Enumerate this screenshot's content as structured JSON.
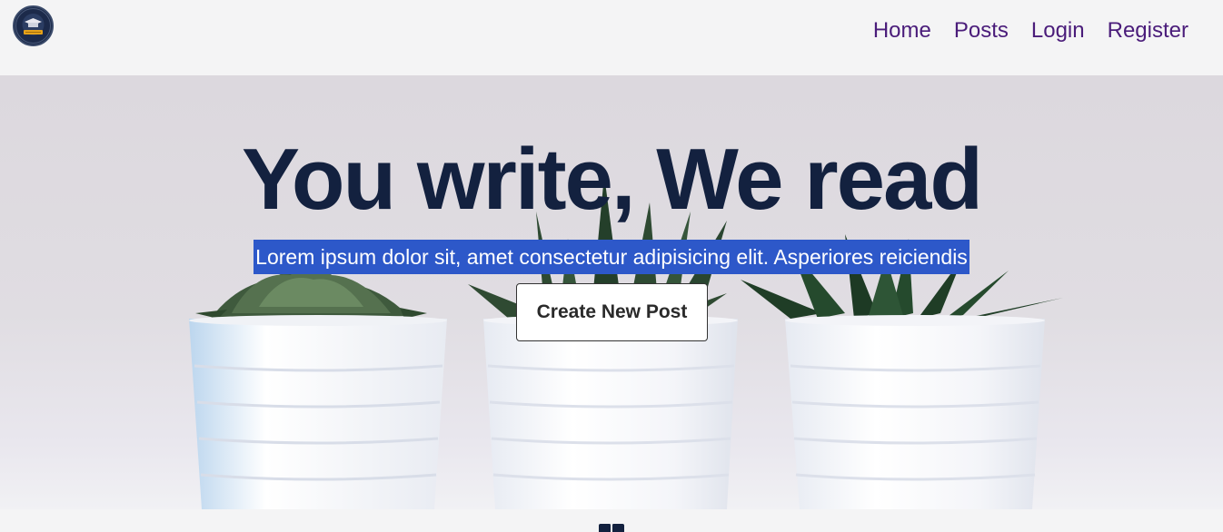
{
  "nav": {
    "logo_icon": "graduation-cap-logo-icon",
    "links": [
      {
        "label": "Home"
      },
      {
        "label": "Posts"
      },
      {
        "label": "Login"
      },
      {
        "label": "Register"
      }
    ]
  },
  "hero": {
    "title": "You write, We read",
    "subtitle": "Lorem ipsum dolor sit, amet consectetur adipisicing elit. Asperiores reiciendis",
    "cta_label": "Create New Post"
  },
  "footer": {
    "icon": "book-icon"
  },
  "colors": {
    "nav_link": "#4a1c7a",
    "title": "#13213f",
    "highlight": "#2d58c9",
    "background": "#f4f4f5"
  }
}
